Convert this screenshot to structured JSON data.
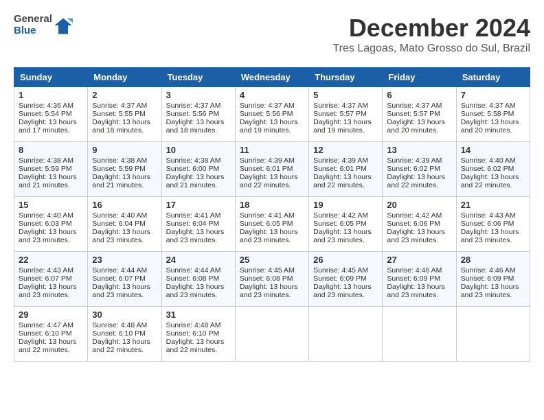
{
  "logo": {
    "text_general": "General",
    "text_blue": "Blue"
  },
  "title": "December 2024",
  "location": "Tres Lagoas, Mato Grosso do Sul, Brazil",
  "weekdays": [
    "Sunday",
    "Monday",
    "Tuesday",
    "Wednesday",
    "Thursday",
    "Friday",
    "Saturday"
  ],
  "weeks": [
    [
      {
        "day": "1",
        "lines": [
          "Sunrise: 4:36 AM",
          "Sunset: 5:54 PM",
          "Daylight: 13 hours",
          "and 17 minutes."
        ]
      },
      {
        "day": "2",
        "lines": [
          "Sunrise: 4:37 AM",
          "Sunset: 5:55 PM",
          "Daylight: 13 hours",
          "and 18 minutes."
        ]
      },
      {
        "day": "3",
        "lines": [
          "Sunrise: 4:37 AM",
          "Sunset: 5:56 PM",
          "Daylight: 13 hours",
          "and 18 minutes."
        ]
      },
      {
        "day": "4",
        "lines": [
          "Sunrise: 4:37 AM",
          "Sunset: 5:56 PM",
          "Daylight: 13 hours",
          "and 19 minutes."
        ]
      },
      {
        "day": "5",
        "lines": [
          "Sunrise: 4:37 AM",
          "Sunset: 5:57 PM",
          "Daylight: 13 hours",
          "and 19 minutes."
        ]
      },
      {
        "day": "6",
        "lines": [
          "Sunrise: 4:37 AM",
          "Sunset: 5:57 PM",
          "Daylight: 13 hours",
          "and 20 minutes."
        ]
      },
      {
        "day": "7",
        "lines": [
          "Sunrise: 4:37 AM",
          "Sunset: 5:58 PM",
          "Daylight: 13 hours",
          "and 20 minutes."
        ]
      }
    ],
    [
      {
        "day": "8",
        "lines": [
          "Sunrise: 4:38 AM",
          "Sunset: 5:59 PM",
          "Daylight: 13 hours",
          "and 21 minutes."
        ]
      },
      {
        "day": "9",
        "lines": [
          "Sunrise: 4:38 AM",
          "Sunset: 5:59 PM",
          "Daylight: 13 hours",
          "and 21 minutes."
        ]
      },
      {
        "day": "10",
        "lines": [
          "Sunrise: 4:38 AM",
          "Sunset: 6:00 PM",
          "Daylight: 13 hours",
          "and 21 minutes."
        ]
      },
      {
        "day": "11",
        "lines": [
          "Sunrise: 4:39 AM",
          "Sunset: 6:01 PM",
          "Daylight: 13 hours",
          "and 22 minutes."
        ]
      },
      {
        "day": "12",
        "lines": [
          "Sunrise: 4:39 AM",
          "Sunset: 6:01 PM",
          "Daylight: 13 hours",
          "and 22 minutes."
        ]
      },
      {
        "day": "13",
        "lines": [
          "Sunrise: 4:39 AM",
          "Sunset: 6:02 PM",
          "Daylight: 13 hours",
          "and 22 minutes."
        ]
      },
      {
        "day": "14",
        "lines": [
          "Sunrise: 4:40 AM",
          "Sunset: 6:02 PM",
          "Daylight: 13 hours",
          "and 22 minutes."
        ]
      }
    ],
    [
      {
        "day": "15",
        "lines": [
          "Sunrise: 4:40 AM",
          "Sunset: 6:03 PM",
          "Daylight: 13 hours",
          "and 23 minutes."
        ]
      },
      {
        "day": "16",
        "lines": [
          "Sunrise: 4:40 AM",
          "Sunset: 6:04 PM",
          "Daylight: 13 hours",
          "and 23 minutes."
        ]
      },
      {
        "day": "17",
        "lines": [
          "Sunrise: 4:41 AM",
          "Sunset: 6:04 PM",
          "Daylight: 13 hours",
          "and 23 minutes."
        ]
      },
      {
        "day": "18",
        "lines": [
          "Sunrise: 4:41 AM",
          "Sunset: 6:05 PM",
          "Daylight: 13 hours",
          "and 23 minutes."
        ]
      },
      {
        "day": "19",
        "lines": [
          "Sunrise: 4:42 AM",
          "Sunset: 6:05 PM",
          "Daylight: 13 hours",
          "and 23 minutes."
        ]
      },
      {
        "day": "20",
        "lines": [
          "Sunrise: 4:42 AM",
          "Sunset: 6:06 PM",
          "Daylight: 13 hours",
          "and 23 minutes."
        ]
      },
      {
        "day": "21",
        "lines": [
          "Sunrise: 4:43 AM",
          "Sunset: 6:06 PM",
          "Daylight: 13 hours",
          "and 23 minutes."
        ]
      }
    ],
    [
      {
        "day": "22",
        "lines": [
          "Sunrise: 4:43 AM",
          "Sunset: 6:07 PM",
          "Daylight: 13 hours",
          "and 23 minutes."
        ]
      },
      {
        "day": "23",
        "lines": [
          "Sunrise: 4:44 AM",
          "Sunset: 6:07 PM",
          "Daylight: 13 hours",
          "and 23 minutes."
        ]
      },
      {
        "day": "24",
        "lines": [
          "Sunrise: 4:44 AM",
          "Sunset: 6:08 PM",
          "Daylight: 13 hours",
          "and 23 minutes."
        ]
      },
      {
        "day": "25",
        "lines": [
          "Sunrise: 4:45 AM",
          "Sunset: 6:08 PM",
          "Daylight: 13 hours",
          "and 23 minutes."
        ]
      },
      {
        "day": "26",
        "lines": [
          "Sunrise: 4:45 AM",
          "Sunset: 6:09 PM",
          "Daylight: 13 hours",
          "and 23 minutes."
        ]
      },
      {
        "day": "27",
        "lines": [
          "Sunrise: 4:46 AM",
          "Sunset: 6:09 PM",
          "Daylight: 13 hours",
          "and 23 minutes."
        ]
      },
      {
        "day": "28",
        "lines": [
          "Sunrise: 4:46 AM",
          "Sunset: 6:09 PM",
          "Daylight: 13 hours",
          "and 23 minutes."
        ]
      }
    ],
    [
      {
        "day": "29",
        "lines": [
          "Sunrise: 4:47 AM",
          "Sunset: 6:10 PM",
          "Daylight: 13 hours",
          "and 22 minutes."
        ]
      },
      {
        "day": "30",
        "lines": [
          "Sunrise: 4:48 AM",
          "Sunset: 6:10 PM",
          "Daylight: 13 hours",
          "and 22 minutes."
        ]
      },
      {
        "day": "31",
        "lines": [
          "Sunrise: 4:48 AM",
          "Sunset: 6:10 PM",
          "Daylight: 13 hours",
          "and 22 minutes."
        ]
      },
      null,
      null,
      null,
      null
    ]
  ]
}
